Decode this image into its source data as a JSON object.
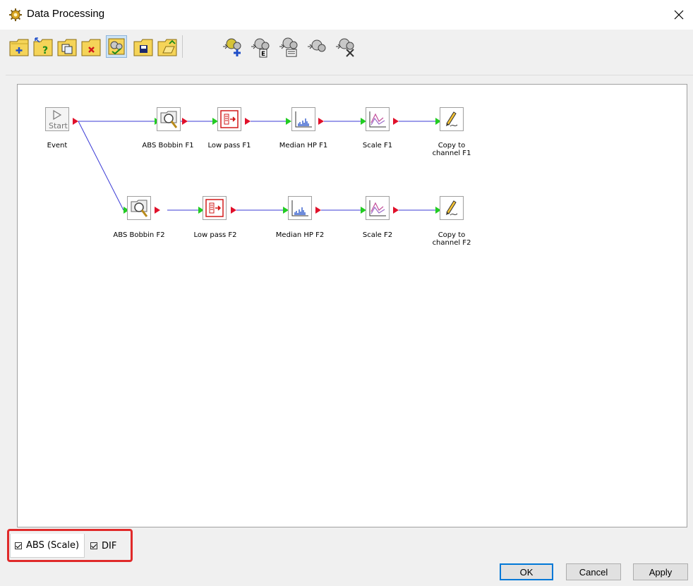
{
  "window": {
    "title": "Data Processing",
    "close_glyph": "✕",
    "icon": "gear-cluster-icon"
  },
  "toolbar": {
    "buttons": [
      {
        "name": "new-folder-button",
        "icon": "folder-plus-icon"
      },
      {
        "name": "query-folder-button",
        "icon": "folder-help-icon"
      },
      {
        "name": "copy-folder-button",
        "icon": "folder-copy-icon"
      },
      {
        "name": "delete-folder-button",
        "icon": "folder-delete-icon"
      },
      {
        "name": "process-toggle-button",
        "icon": "gears-check-icon",
        "pressed": true
      },
      {
        "name": "save-folder-button",
        "icon": "folder-save-icon"
      },
      {
        "name": "open-folder-button",
        "icon": "folder-open-icon"
      },
      {
        "name": "add-process-button",
        "icon": "gears-add-icon"
      },
      {
        "name": "edit-process-button",
        "icon": "gears-edit-icon"
      },
      {
        "name": "list-process-button",
        "icon": "gears-list-icon"
      },
      {
        "name": "run-process-button",
        "icon": "gears-run-icon"
      },
      {
        "name": "remove-process-button",
        "icon": "gears-remove-icon"
      }
    ]
  },
  "graph": {
    "wire_color": "#3b3bd6",
    "nodes": {
      "event": {
        "label": "Event",
        "start_text": "Start"
      },
      "abs_f1": {
        "label": "ABS Bobbin F1"
      },
      "low_f1": {
        "label": "Low pass F1"
      },
      "med_f1": {
        "label": "Median HP F1"
      },
      "scale_f1": {
        "label": "Scale F1"
      },
      "copy_f1": {
        "label_line1": "Copy to",
        "label_line2": "channel F1"
      },
      "abs_f2": {
        "label": "ABS Bobbin F2"
      },
      "low_f2": {
        "label": "Low pass F2"
      },
      "med_f2": {
        "label": "Median HP F2"
      },
      "scale_f2": {
        "label": "Scale F2"
      },
      "copy_f2": {
        "label_line1": "Copy to",
        "label_line2": "channel F2"
      }
    }
  },
  "tabs": [
    {
      "label": "ABS (Scale)",
      "checked": true,
      "active": true
    },
    {
      "label": "DIF",
      "checked": true,
      "active": false
    }
  ],
  "buttons": {
    "ok": "OK",
    "cancel": "Cancel",
    "apply": "Apply"
  },
  "colors": {
    "highlight": "#e02a2a",
    "port_in": "#22cc22",
    "port_out": "#e0102a"
  }
}
